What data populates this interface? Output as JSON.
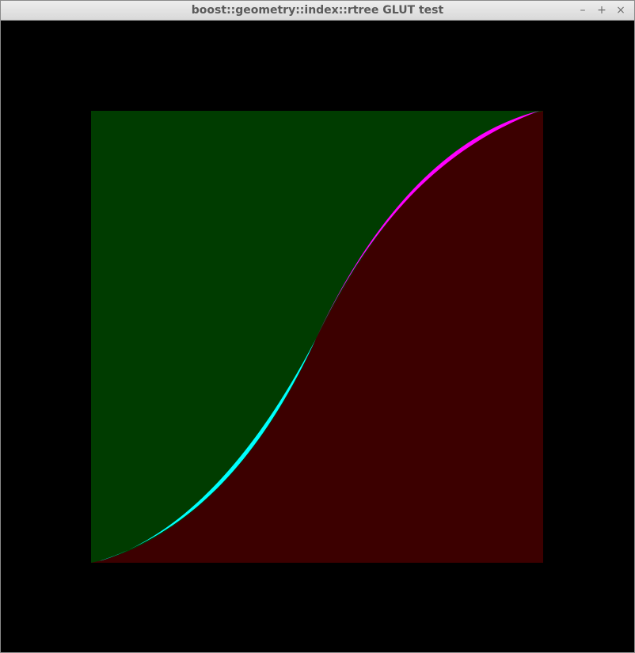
{
  "window": {
    "title": "boost::geometry::index::rtree GLUT test",
    "minimize_glyph": "–",
    "maximize_glyph": "+",
    "close_glyph": "×"
  },
  "scene": {
    "background_color": "#000000",
    "upper_region_color": "#003c00",
    "lower_region_color": "#3c0000",
    "lower_band_color": "#00ffff",
    "upper_band_color": "#ff00ff"
  }
}
